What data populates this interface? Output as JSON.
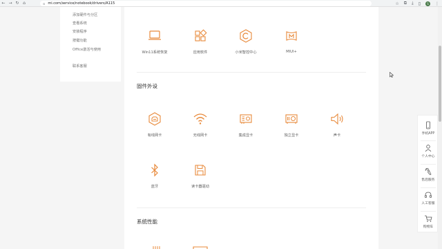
{
  "browser": {
    "url": "mi.com/service/notebook/drivers/A115",
    "profile_initial": "S"
  },
  "left_menu": {
    "items": [
      {
        "label": "添加硬件与分区"
      },
      {
        "label": "查看系统"
      },
      {
        "label": "安装程序"
      },
      {
        "label": "按键功能"
      },
      {
        "label": "Office激活与使用"
      },
      {
        "label": "联系客服"
      }
    ]
  },
  "apps_row": [
    {
      "label": "Win11系统恢复",
      "icon": "laptop-icon"
    },
    {
      "label": "应用软件",
      "icon": "apps-grid-icon"
    },
    {
      "label": "小米智控中心",
      "icon": "hexagon-c-icon"
    },
    {
      "label": "MIUI+",
      "icon": "miui-plus-icon"
    }
  ],
  "firmware": {
    "title": "固件外设",
    "items": [
      {
        "label": "有线网卡",
        "icon": "ethernet-icon"
      },
      {
        "label": "无线网卡",
        "icon": "wifi-icon"
      },
      {
        "label": "集成显卡",
        "icon": "integrated-gpu-icon"
      },
      {
        "label": "独立显卡",
        "icon": "discrete-gpu-icon"
      },
      {
        "label": "声卡",
        "icon": "speaker-icon"
      },
      {
        "label": "蓝牙",
        "icon": "bluetooth-icon"
      },
      {
        "label": "读卡器驱动",
        "icon": "sd-card-icon"
      }
    ]
  },
  "performance": {
    "title": "系统性能"
  },
  "float_bar": {
    "items": [
      {
        "label": "手机APP",
        "icon": "phone-icon"
      },
      {
        "label": "个人中心",
        "icon": "user-icon"
      },
      {
        "label": "售后服务",
        "icon": "wrench-icon"
      },
      {
        "label": "人工客服",
        "icon": "headset-icon"
      },
      {
        "label": "购物车",
        "icon": "cart-icon"
      }
    ]
  },
  "colors": {
    "accent": "#e8893a",
    "page_bg": "#f5f5f5"
  }
}
